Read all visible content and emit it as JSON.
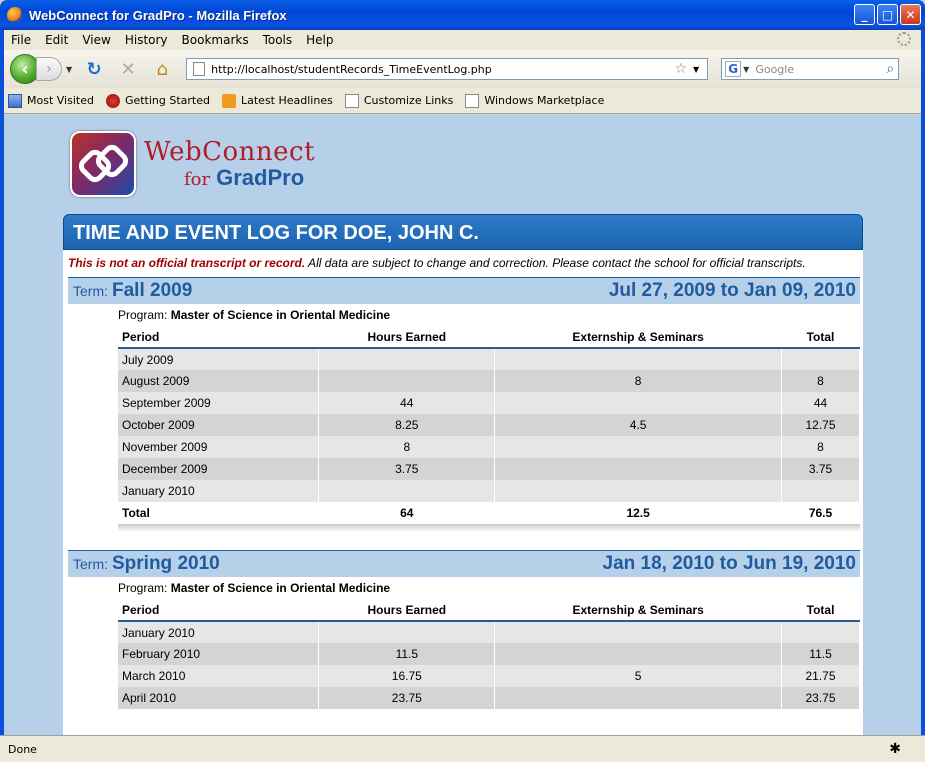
{
  "window": {
    "title": "WebConnect for GradPro - Mozilla Firefox",
    "min": "_",
    "max": "□",
    "close": "✕"
  },
  "menu": [
    "File",
    "Edit",
    "View",
    "History",
    "Bookmarks",
    "Tools",
    "Help"
  ],
  "nav": {
    "back": "‹",
    "forward": "›",
    "url": "http://localhost/studentRecords_TimeEventLog.php",
    "search_placeholder": "Google"
  },
  "bookmarks": [
    "Most Visited",
    "Getting Started",
    "Latest Headlines",
    "Customize Links",
    "Windows Marketplace"
  ],
  "brand": {
    "line1": "WebConnect",
    "line2_for": "for",
    "line2_name": "GradPro"
  },
  "page": {
    "heading": "TIME AND EVENT LOG FOR DOE, JOHN C.",
    "disclaimer_bold": "This is not an official transcript or record.",
    "disclaimer_rest": " All data are subject to change and correction. Please contact the school for official transcripts."
  },
  "columns": {
    "period": "Period",
    "hours": "Hours Earned",
    "extern": "Externship & Seminars",
    "total": "Total"
  },
  "terms": [
    {
      "label": "Term:",
      "name": "Fall 2009",
      "dates": "Jul 27, 2009 to Jan 09, 2010",
      "program_label": "Program:",
      "program": "Master of Science in Oriental Medicine",
      "rows": [
        {
          "period": "July 2009",
          "hours": "",
          "extern": "",
          "total": ""
        },
        {
          "period": "August 2009",
          "hours": "",
          "extern": "8",
          "total": "8"
        },
        {
          "period": "September 2009",
          "hours": "44",
          "extern": "",
          "total": "44"
        },
        {
          "period": "October 2009",
          "hours": "8.25",
          "extern": "4.5",
          "total": "12.75"
        },
        {
          "period": "November 2009",
          "hours": "8",
          "extern": "",
          "total": "8"
        },
        {
          "period": "December 2009",
          "hours": "3.75",
          "extern": "",
          "total": "3.75"
        },
        {
          "period": "January 2010",
          "hours": "",
          "extern": "",
          "total": ""
        }
      ],
      "totals": {
        "period": "Total",
        "hours": "64",
        "extern": "12.5",
        "total": "76.5"
      }
    },
    {
      "label": "Term:",
      "name": "Spring 2010",
      "dates": "Jan 18, 2010 to Jun 19, 2010",
      "program_label": "Program:",
      "program": "Master of Science in Oriental Medicine",
      "rows": [
        {
          "period": "January 2010",
          "hours": "",
          "extern": "",
          "total": ""
        },
        {
          "period": "February 2010",
          "hours": "11.5",
          "extern": "",
          "total": "11.5"
        },
        {
          "period": "March 2010",
          "hours": "16.75",
          "extern": "5",
          "total": "21.75"
        },
        {
          "period": "April 2010",
          "hours": "23.75",
          "extern": "",
          "total": "23.75"
        }
      ]
    }
  ],
  "status": "Done"
}
